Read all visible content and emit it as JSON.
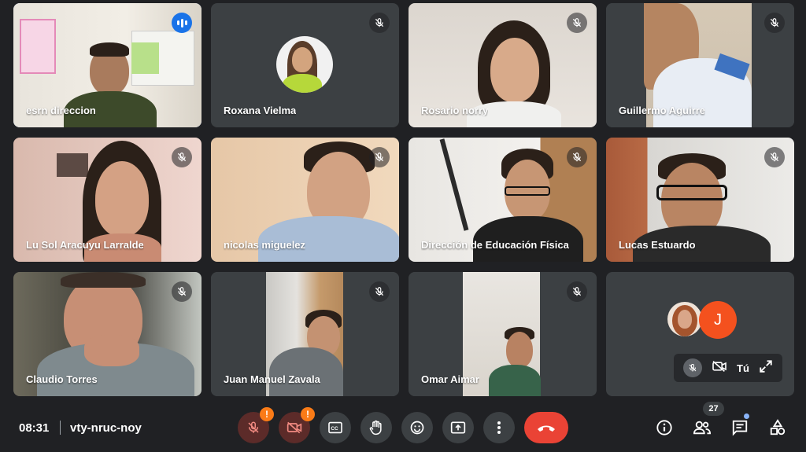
{
  "participants": [
    {
      "name": "esrn direccion",
      "speaking": true
    },
    {
      "name": "Roxana Vielma",
      "muted": true
    },
    {
      "name": "Rosario norry",
      "muted": true
    },
    {
      "name": "Guillermo Aguirre",
      "muted": true
    },
    {
      "name": "Lu Sol Aracuyu Larralde",
      "muted": true
    },
    {
      "name": "nicolas miguelez",
      "muted": true
    },
    {
      "name": "Dirección de Educación Física",
      "muted": true
    },
    {
      "name": "Lucas Estuardo",
      "muted": true
    },
    {
      "name": "Claudio Torres",
      "muted": true
    },
    {
      "name": "Juan Manuel Zavala",
      "muted": true
    },
    {
      "name": "Omar Aimar",
      "muted": true
    }
  ],
  "self_tile": {
    "avatar_letter": "J",
    "label": "Tú"
  },
  "meeting": {
    "time": "08:31",
    "code": "vty-nruc-noy"
  },
  "controls": {
    "mic_warning": "!",
    "cam_warning": "!"
  },
  "people_count": "27",
  "colors": {
    "background": "#202124",
    "tile": "#3c4043",
    "accent_blue": "#8ab4f8",
    "end_call": "#ea4335",
    "warning": "#fa7b17",
    "avatar_j": "#f4511e"
  },
  "icons": [
    "mic-off-icon",
    "camera-off-icon",
    "captions-icon",
    "raise-hand-icon",
    "emoji-icon",
    "present-icon",
    "more-icon",
    "end-call-icon",
    "info-icon",
    "people-icon",
    "chat-icon",
    "activities-icon",
    "expand-icon",
    "speaking-icon"
  ]
}
